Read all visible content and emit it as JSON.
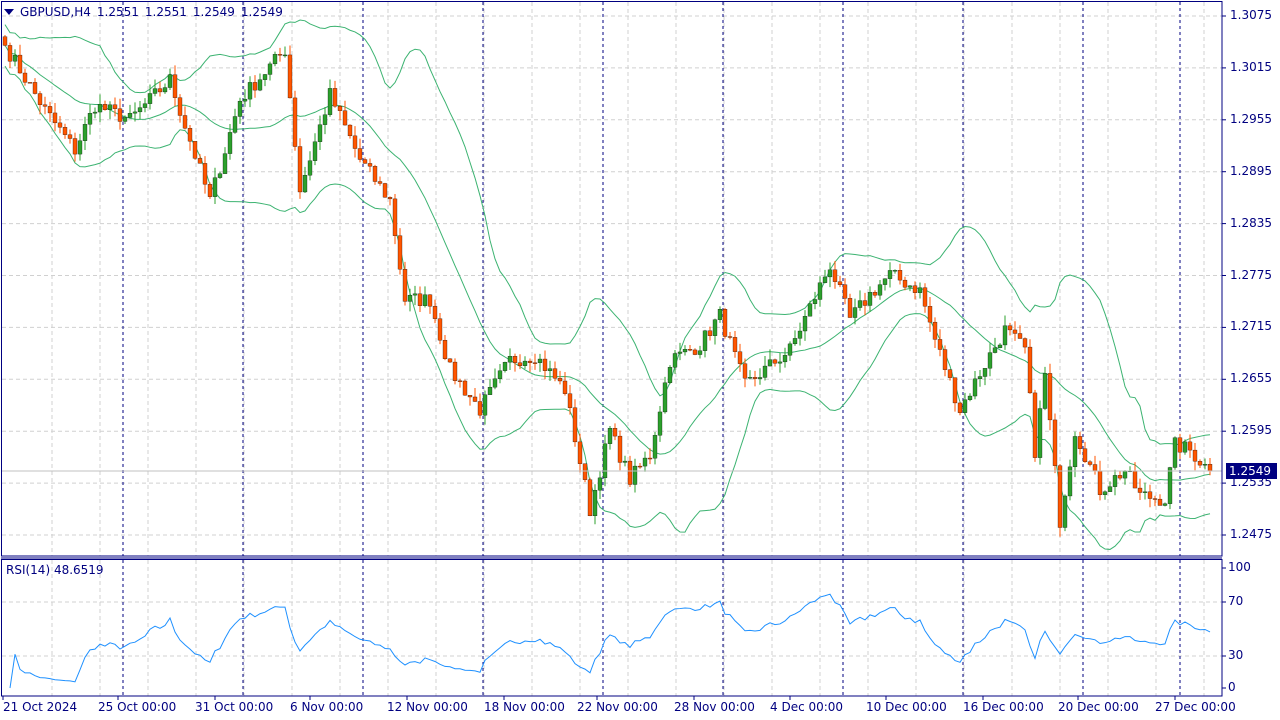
{
  "header": {
    "symbol_timeframe": "GBPUSD,H4",
    "open": "1.2551",
    "high": "1.2551",
    "low": "1.2549",
    "close": "1.2549"
  },
  "rsi": {
    "title": "RSI(14) 48.6519",
    "levels": [
      "100",
      "70",
      "30",
      "0"
    ]
  },
  "last_price": "1.2549",
  "colors": {
    "axis": "#000080",
    "bull": "#2ca02c",
    "bear": "#ff5500",
    "bands": "#3cb371",
    "rsi": "#1e90ff",
    "grid": "#d0d0d0"
  },
  "chart_data": {
    "type": "candlestick",
    "title": "GBPUSD,H4",
    "price_ticks": [
      "1.3075",
      "1.3015",
      "1.2955",
      "1.2895",
      "1.2835",
      "1.2775",
      "1.2715",
      "1.2655",
      "1.2595",
      "1.2535",
      "1.2475"
    ],
    "ylim": [
      1.2475,
      1.3075
    ],
    "time_ticks": [
      "21 Oct 2024",
      "25 Oct 00:00",
      "31 Oct 00:00",
      "6 Nov 00:00",
      "12 Nov 00:00",
      "18 Nov 00:00",
      "22 Nov 00:00",
      "28 Nov 00:00",
      "4 Dec 00:00",
      "10 Dec 00:00",
      "16 Dec 00:00",
      "20 Dec 00:00",
      "27 Dec 00:00"
    ],
    "indicators": [
      "Bollinger Bands",
      "RSI(14)"
    ],
    "close_anchors": [
      [
        0,
        1.3041
      ],
      [
        8,
        1.2966
      ],
      [
        14,
        1.292
      ],
      [
        18,
        1.2972
      ],
      [
        25,
        1.2955
      ],
      [
        33,
        1.3001
      ],
      [
        41,
        1.2862
      ],
      [
        47,
        1.2978
      ],
      [
        56,
        1.3036
      ],
      [
        59,
        1.2874
      ],
      [
        65,
        1.2984
      ],
      [
        71,
        1.2909
      ],
      [
        77,
        1.2862
      ],
      [
        80,
        1.2747
      ],
      [
        85,
        1.2747
      ],
      [
        89,
        1.2666
      ],
      [
        95,
        1.262
      ],
      [
        101,
        1.2677
      ],
      [
        106,
        1.2683
      ],
      [
        112,
        1.2643
      ],
      [
        117,
        1.2504
      ],
      [
        121,
        1.2596
      ],
      [
        125,
        1.2539
      ],
      [
        129,
        1.2568
      ],
      [
        133,
        1.2677
      ],
      [
        139,
        1.2695
      ],
      [
        143,
        1.2729
      ],
      [
        148,
        1.2648
      ],
      [
        157,
        1.2689
      ],
      [
        165,
        1.2787
      ],
      [
        169,
        1.2724
      ],
      [
        173,
        1.2753
      ],
      [
        177,
        1.2776
      ],
      [
        183,
        1.2758
      ],
      [
        186,
        1.2701
      ],
      [
        191,
        1.262
      ],
      [
        197,
        1.2683
      ],
      [
        200,
        1.2712
      ],
      [
        204,
        1.2689
      ],
      [
        206,
        1.2573
      ],
      [
        208,
        1.266
      ],
      [
        211,
        1.2492
      ],
      [
        214,
        1.2596
      ],
      [
        219,
        1.2527
      ],
      [
        224,
        1.255
      ],
      [
        227,
        1.2521
      ],
      [
        232,
        1.2516
      ],
      [
        234,
        1.2579
      ],
      [
        237,
        1.2573
      ],
      [
        241,
        1.2549
      ]
    ]
  }
}
